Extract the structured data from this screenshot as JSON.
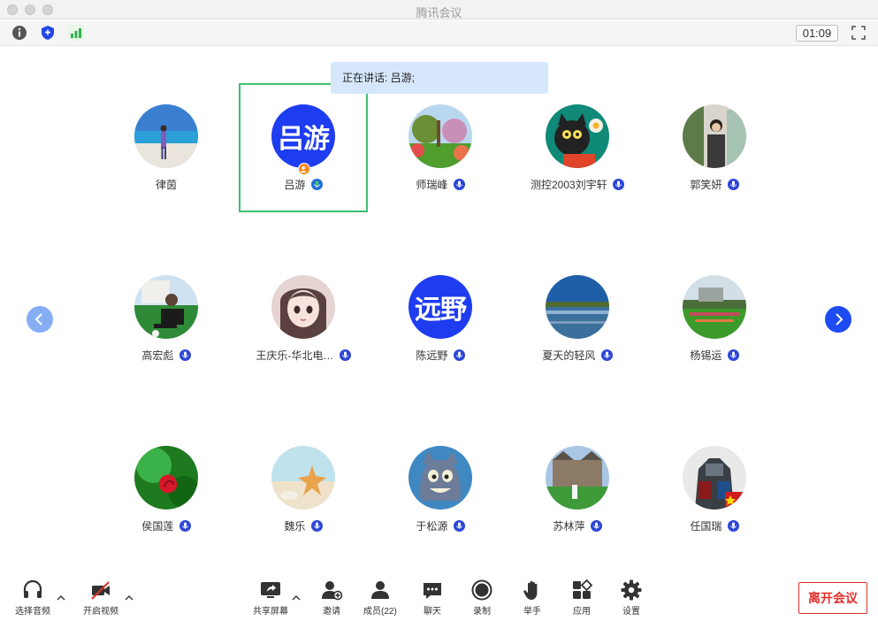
{
  "window": {
    "title": "腾讯会议"
  },
  "infobar": {
    "timer": "01:09"
  },
  "speaking": {
    "prefix": "正在讲话: ",
    "name": "吕游;"
  },
  "participants": [
    {
      "name": "律茵",
      "avatar": "photo-sea",
      "mic": false
    },
    {
      "name": "吕游",
      "avatar": "text",
      "avatar_text": "吕游",
      "mic": true,
      "mic_active": true,
      "host": true,
      "active": true
    },
    {
      "name": "师瑞峰",
      "avatar": "photo-garden",
      "mic": true
    },
    {
      "name": "测控2003刘宇轩",
      "avatar": "photo-cartoon-cat",
      "mic": true
    },
    {
      "name": "郭笑妍",
      "avatar": "photo-girl",
      "mic": true
    },
    {
      "name": "高宏彪",
      "avatar": "photo-grass-man",
      "mic": true
    },
    {
      "name": "王庆乐-华北电…",
      "avatar": "photo-anime-girl",
      "mic": true
    },
    {
      "name": "陈远野",
      "avatar": "text",
      "avatar_text": "远野",
      "mic": true
    },
    {
      "name": "夏天的轻风",
      "avatar": "photo-lake",
      "mic": true
    },
    {
      "name": "杨锡运",
      "avatar": "photo-lawn",
      "mic": true
    },
    {
      "name": "侯国莲",
      "avatar": "photo-flower",
      "mic": true
    },
    {
      "name": "魏乐",
      "avatar": "photo-starfish",
      "mic": true
    },
    {
      "name": "于松源",
      "avatar": "photo-tom-cat",
      "mic": true
    },
    {
      "name": "苏林萍",
      "avatar": "photo-building",
      "mic": true
    },
    {
      "name": "任国瑞",
      "avatar": "photo-robot",
      "mic": true
    }
  ],
  "toolbar": {
    "audio": "选择音频",
    "video": "开启视频",
    "share": "共享屏幕",
    "invite": "邀请",
    "members": "成员(22)",
    "chat": "聊天",
    "record": "录制",
    "hand": "举手",
    "apps": "应用",
    "settings": "设置",
    "leave": "离开会议"
  },
  "colors": {
    "accent": "#1f4bf3",
    "active_border": "#3fc070",
    "leave": "#e0302b",
    "speaking_bg": "#d7e7fb"
  }
}
